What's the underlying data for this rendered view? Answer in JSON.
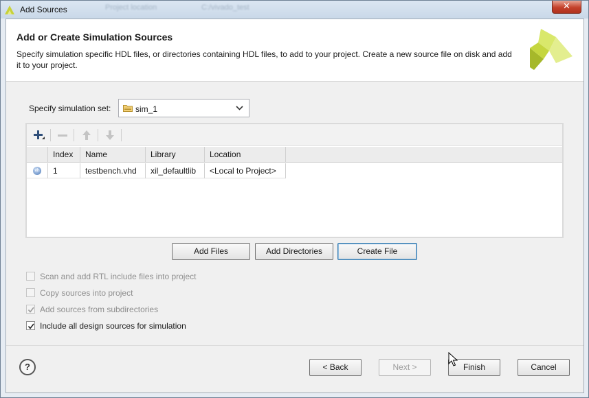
{
  "window": {
    "title": "Add Sources",
    "background_text": [
      "Project location",
      "C:/vivado_test"
    ],
    "close_glyph": "✕"
  },
  "header": {
    "title": "Add or Create Simulation Sources",
    "description": "Specify simulation specific HDL files, or directories containing HDL files, to add to your project. Create a new source file on disk and add it to your project.",
    "logo_icon": "xilinx-logo-icon"
  },
  "simset": {
    "label": "Specify simulation set:",
    "value": "sim_1",
    "icon": "folder-icon"
  },
  "toolbar": {
    "items": [
      {
        "icon": "plus-icon",
        "enabled": true
      },
      {
        "icon": "minus-icon",
        "enabled": false
      },
      {
        "icon": "arrow-up-icon",
        "enabled": false
      },
      {
        "icon": "arrow-down-icon",
        "enabled": false
      }
    ]
  },
  "table": {
    "columns": [
      "Index",
      "Name",
      "Library",
      "Location"
    ],
    "rows": [
      {
        "icon": "vhd-file-icon",
        "icon_text": "vh",
        "index": "1",
        "name": "testbench.vhd",
        "library": "xil_defaultlib",
        "location": "<Local to Project>"
      }
    ]
  },
  "actions": {
    "add_files": "Add Files",
    "add_directories": "Add Directories",
    "create_file": "Create File"
  },
  "options": [
    {
      "label": "Scan and add RTL include files into project",
      "checked": false,
      "enabled": false
    },
    {
      "label": "Copy sources into project",
      "checked": false,
      "enabled": false
    },
    {
      "label": "Add sources from subdirectories",
      "checked": true,
      "enabled": false
    },
    {
      "label": "Include all design sources for simulation",
      "checked": true,
      "enabled": true
    }
  ],
  "footer": {
    "help": "?",
    "back": "< Back",
    "next": "Next >",
    "finish": "Finish",
    "cancel": "Cancel"
  },
  "colors": {
    "accent": "#3c7fb1",
    "logo_light": "#d9e86b",
    "logo_dark": "#a6b82a"
  }
}
